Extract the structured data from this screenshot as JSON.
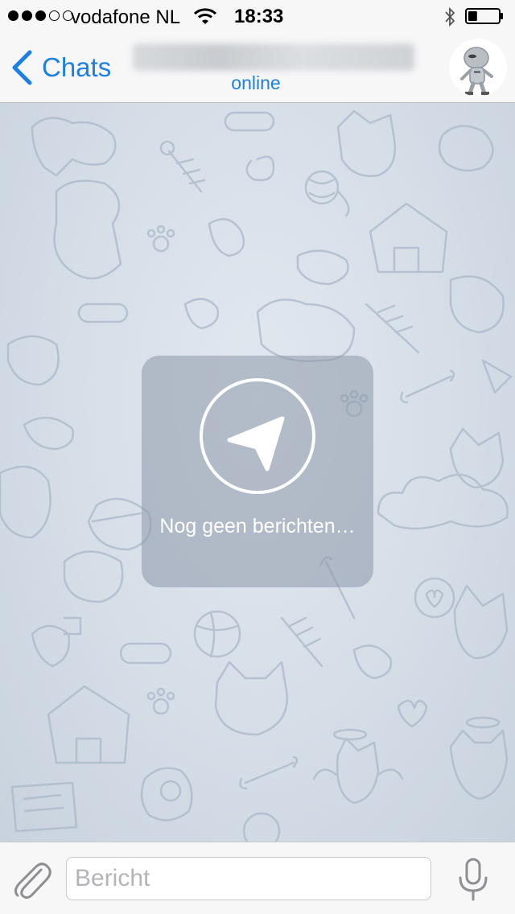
{
  "status_bar": {
    "signal": {
      "filled": 3,
      "total": 5
    },
    "carrier": "vodafone NL",
    "time": "18:33",
    "bluetooth_icon": "bluetooth-icon",
    "battery_level": 0.3
  },
  "nav": {
    "back_label": "Chats",
    "status": "online",
    "accent": "#1c7fe3"
  },
  "empty_state": {
    "icon": "paper-plane-icon",
    "message": "Nog geen berichten…"
  },
  "composer": {
    "placeholder": "Bericht",
    "value": "",
    "attach_icon": "paperclip-icon",
    "mic_icon": "microphone-icon"
  }
}
